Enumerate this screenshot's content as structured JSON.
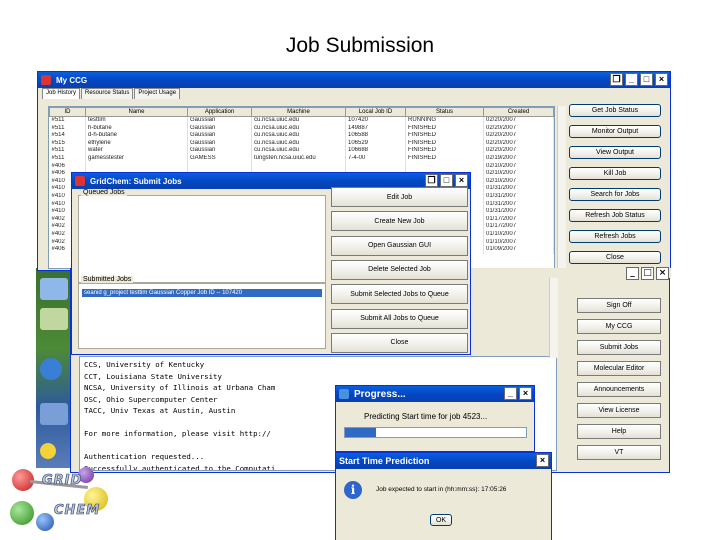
{
  "slide_title": "Job Submission",
  "main_window": {
    "title": "My CCG",
    "tabs": [
      "Job History",
      "Resource Status",
      "Project Usage"
    ],
    "columns": [
      "ID",
      "Name",
      "Application",
      "Machine",
      "Local Job ID",
      "Status",
      "Created"
    ],
    "rows": [
      [
        "#511",
        "testtim",
        "Gaussian",
        "cu.ncsa.uiuc.edu",
        "107420",
        "RUNNING",
        "02/20/2007"
      ],
      [
        "#511",
        "h-butane",
        "Gaussian",
        "cu.ncsa.uiuc.edu",
        "149887",
        "FINISHED",
        "02/20/2007"
      ],
      [
        "#514",
        "d-h-butane",
        "Gaussian",
        "cu.ncsa.uiuc.edu",
        "106588",
        "FINISHED",
        "02/20/2007"
      ],
      [
        "#515",
        "ethylene",
        "Gaussian",
        "cu.ncsa.uiuc.edu",
        "106529",
        "FINISHED",
        "02/20/2007"
      ],
      [
        "#511",
        "water",
        "Gaussian",
        "cu.ncsa.uiuc.edu",
        "106688",
        "FINISHED",
        "02/20/2007"
      ],
      [
        "#511",
        "gamesstester",
        "GAMESS",
        "tungsten.ncsa.uiuc.edu",
        "7-4-00",
        "FINISHED",
        "02/19/2007"
      ],
      [
        "#406",
        "",
        "",
        "",
        "",
        "",
        "02/10/2007"
      ],
      [
        "#406",
        "",
        "",
        "",
        "",
        "",
        "02/10/2007"
      ],
      [
        "#410",
        "",
        "",
        "",
        "",
        "",
        "02/10/2007"
      ],
      [
        "#410",
        "",
        "",
        "",
        "",
        "",
        "01/31/2007"
      ],
      [
        "#410",
        "",
        "",
        "",
        "",
        "",
        "01/31/2007"
      ],
      [
        "#410",
        "",
        "",
        "",
        "",
        "",
        "01/31/2007"
      ],
      [
        "#410",
        "",
        "",
        "",
        "",
        "",
        "01/31/2007"
      ],
      [
        "#402",
        "",
        "",
        "",
        "",
        "",
        "01/17/2007"
      ],
      [
        "#402",
        "",
        "",
        "",
        "",
        "",
        "01/17/2007"
      ],
      [
        "#402",
        "",
        "",
        "",
        "",
        "",
        "01/10/2007"
      ],
      [
        "#402",
        "",
        "",
        "",
        "",
        "",
        "01/10/2007"
      ],
      [
        "#406",
        "",
        "",
        "",
        "",
        "",
        "01/09/2007"
      ]
    ],
    "side_buttons": [
      "Get Job Status",
      "Monitor Output",
      "View Output",
      "Kill Job",
      "Search for Jobs",
      "Refresh Job Status",
      "Refresh Jobs",
      "Close"
    ]
  },
  "submit_window": {
    "title": "GridChem: Submit Jobs",
    "queued_label": "Queued Jobs",
    "submitted_label": "Submitted Jobs",
    "submitted_item": "seanid g_project testtim Gaussian Copper Job ID -- 107420",
    "buttons": [
      "Edit Job",
      "Create New Job",
      "Open Gaussian GUI",
      "Delete Selected Job",
      "Submit Selected Jobs to Queue",
      "Submit All Jobs to Queue",
      "Close"
    ]
  },
  "console_window": {
    "lines": [
      "CCS, University of Kentucky",
      "CCT, Louisiana State University",
      "NCSA, University of Illinois at Urbana Cham",
      "OSC, Ohio Supercomputer Center",
      "TACC, Univ Texas at Austin, Austin",
      "",
      "For more information, please visit http://",
      "",
      "Authentication requested...",
      "Successfully authenticated to the Computati"
    ],
    "side_buttons": [
      "Sign Off",
      "My CCG",
      "Submit Jobs",
      "Molecular Editor",
      "Announcements",
      "View License",
      "Help",
      "VT"
    ]
  },
  "progress_window": {
    "title": "Progress...",
    "message": "Predicting Start time for job 4523...",
    "progress": 0.17
  },
  "prediction_dialog": {
    "title": "Start Time Prediction",
    "message": "Job expected to start in (hh:mm:ss): 17:05:26",
    "ok_label": "OK"
  },
  "logo": {
    "line1": "GRID",
    "line2": "CHEM"
  },
  "colors": {
    "titlebar": "#0a5fe0",
    "finished_status": "#0a7a0a",
    "window_face": "#ece9d8"
  }
}
